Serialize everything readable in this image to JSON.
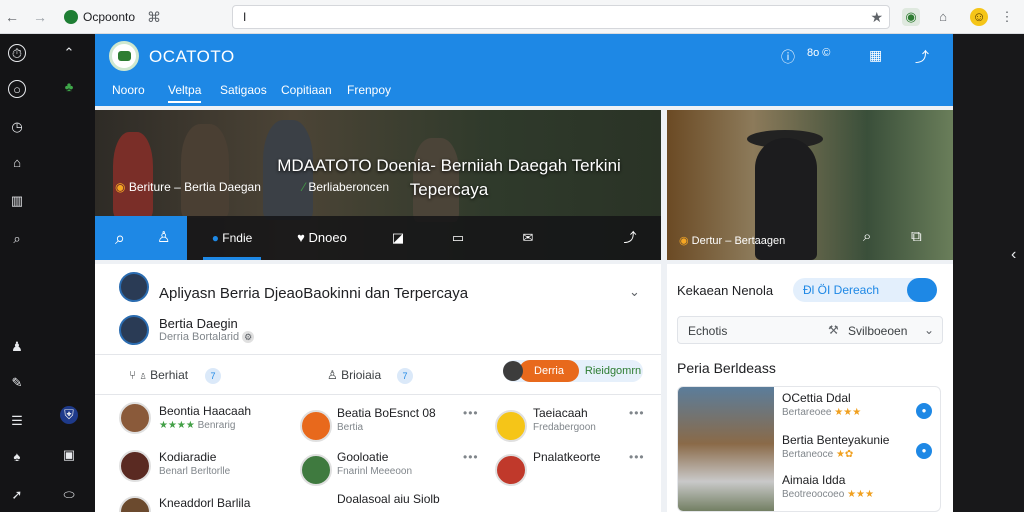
{
  "browser": {
    "back": "←",
    "forward": "→",
    "tab_title": "Ocpoonto",
    "url_value": "I",
    "star": "★"
  },
  "app": {
    "title": "OCATOTO",
    "header_right": "8o ©",
    "tabs": [
      "Nooro",
      "Veltpa",
      "Satigaos",
      "Copitiaan",
      "Frenpoy"
    ]
  },
  "hero": {
    "title_line1": "MDAATOTO Doenia- Berniiah Daegah Terkini",
    "title_line2": "Tepercaya",
    "tag1": "Beriture – Bertia Daegan",
    "tag2": "Berliaberoncen",
    "toolbar": {
      "active_label": "Fndie",
      "label2": "Dnoeo"
    }
  },
  "side_hero": {
    "tag": "Dertur – Bertaagen"
  },
  "main": {
    "section_title": "Apliyasn Berria DjeaoBaokinni dan Terpercaya",
    "subhead": "Bertia Daegin",
    "subhead_sub": "Derria  Bortalarid",
    "filters": {
      "label1": "Berhiat",
      "label2": "Brioiaia",
      "pill_left": "Derria",
      "pill_right": "Rieidgomrn"
    },
    "items": [
      {
        "name": "Beontia Haacaah",
        "sub": "Benrarig"
      },
      {
        "name": "Beatia BoEsnct 08",
        "sub": "Bertia"
      },
      {
        "name": "Taeiacaah",
        "sub": "Fredabergoon"
      },
      {
        "name": "Kodiaradie",
        "sub": "Benarl Berltorlle"
      },
      {
        "name": "Gooloatie",
        "sub": "Fnarinl Meeeoon"
      },
      {
        "name": "Pnalatkeorte",
        "sub": ""
      },
      {
        "name": "Kneaddorl Barlila",
        "sub": ""
      },
      {
        "name": "Doalasoal aiu Siolb",
        "sub": ""
      }
    ]
  },
  "right_card": {
    "title": "Kekaean Nenola",
    "pill": "Ðl ÖI Dereach",
    "select_label": "Echotis",
    "select_value": "Svilboeoen",
    "heading": "Peria Berldeass",
    "items": [
      {
        "title": "OCettia Ddal",
        "sub": "Bertareoee"
      },
      {
        "title": "Bertia Benteyakunie",
        "sub": "Bertaneoce"
      },
      {
        "title": "Aimaia Idda",
        "sub": "Beotreoocoeo"
      }
    ]
  },
  "colors": {
    "accent": "#1e88e5",
    "brand_green": "#2e7d32",
    "orange": "#e8691c"
  }
}
